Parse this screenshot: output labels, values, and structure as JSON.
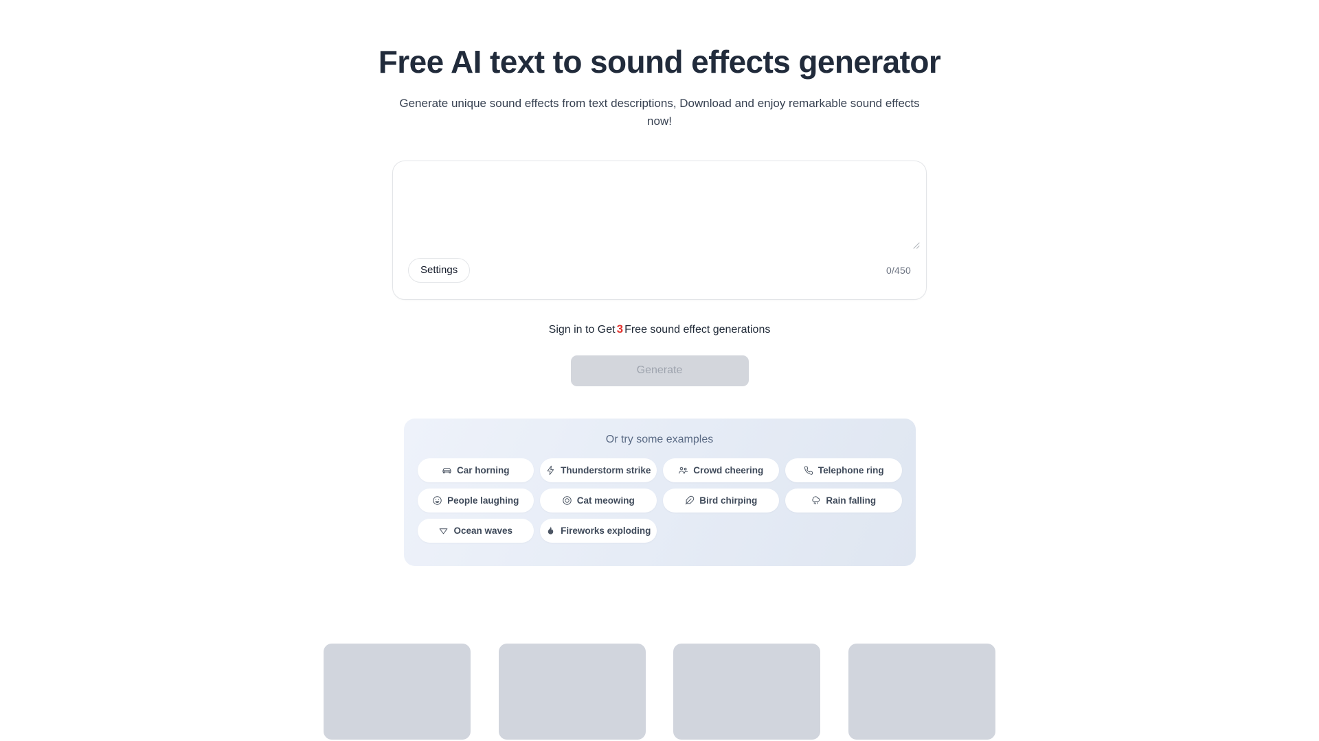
{
  "hero": {
    "title": "Free AI text to sound effects generator",
    "subtitle": "Generate unique sound effects from text descriptions, Download and enjoy remarkable sound effects now!"
  },
  "prompt": {
    "value": "",
    "placeholder": "",
    "settings_label": "Settings",
    "char_counter": "0/450",
    "resize_icon": "resize-grip-icon"
  },
  "signin": {
    "prefix": "Sign in to Get",
    "count": "3",
    "suffix": "Free sound effect generations"
  },
  "generate": {
    "label": "Generate",
    "disabled": true,
    "disabled_bg": "#d3d6dc",
    "disabled_text": "#9ea4ae"
  },
  "examples": {
    "heading": "Or try some examples",
    "items": [
      {
        "label": "Car horning",
        "icon": "car-icon"
      },
      {
        "label": "Thunderstorm strike",
        "icon": "lightning-icon"
      },
      {
        "label": "Crowd cheering",
        "icon": "people-group-icon"
      },
      {
        "label": "Telephone ring",
        "icon": "phone-icon"
      },
      {
        "label": "People laughing",
        "icon": "smiley-laugh-icon"
      },
      {
        "label": "Cat meowing",
        "icon": "paw-circle-icon"
      },
      {
        "label": "Bird chirping",
        "icon": "feather-icon"
      },
      {
        "label": "Rain falling",
        "icon": "cloud-rain-icon"
      },
      {
        "label": "Ocean waves",
        "icon": "wave-triangle-icon"
      },
      {
        "label": "Fireworks exploding",
        "icon": "flame-icon"
      }
    ]
  },
  "skeleton": {
    "count": 4,
    "color": "#d1d5dd"
  },
  "colors": {
    "title": "#212b3b",
    "accent_red": "#e3342f",
    "panel_gradient_start": "#eef2fa",
    "panel_gradient_end": "#dfe6f1",
    "border": "#e3e5e8"
  }
}
